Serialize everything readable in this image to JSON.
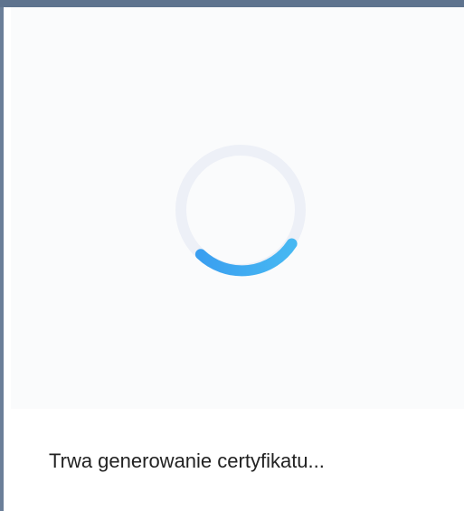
{
  "loader": {
    "status_text": "Trwa generowanie certyfikatu...",
    "spinner_icon": "loading-spinner-icon",
    "colors": {
      "frame": "#5e738e",
      "track": "#eef1f8",
      "arc_start": "#4aa8f0",
      "arc_end": "#2e8be6",
      "panel_background": "#fafbfc"
    }
  }
}
